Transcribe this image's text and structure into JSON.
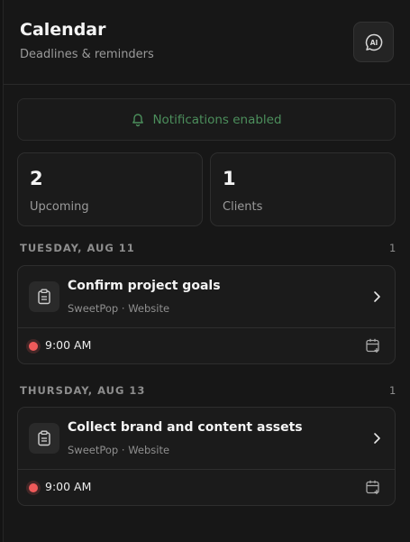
{
  "header": {
    "title": "Calendar",
    "subtitle": "Deadlines & reminders",
    "ai_button_label": "AI"
  },
  "notifications": {
    "label": "Notifications enabled",
    "color": "#4c8f5c",
    "icon": "bell-icon"
  },
  "stats": [
    {
      "value": "2",
      "label": "Upcoming"
    },
    {
      "value": "1",
      "label": "Clients"
    }
  ],
  "days": [
    {
      "label": "TUESDAY, AUG 11",
      "count": "1",
      "task": {
        "title": "Confirm project goals",
        "client": "SweetPop · Website",
        "time": "9:00 AM",
        "icon": "clipboard-icon"
      }
    },
    {
      "label": "THURSDAY, AUG 13",
      "count": "1",
      "task": {
        "title": "Collect brand and content assets",
        "client": "SweetPop · Website",
        "time": "9:00 AM",
        "icon": "clipboard-icon"
      }
    }
  ],
  "colors": {
    "background": "#171717",
    "card": "#1b1b1b",
    "reminder_dot": "#ef5a5a"
  }
}
